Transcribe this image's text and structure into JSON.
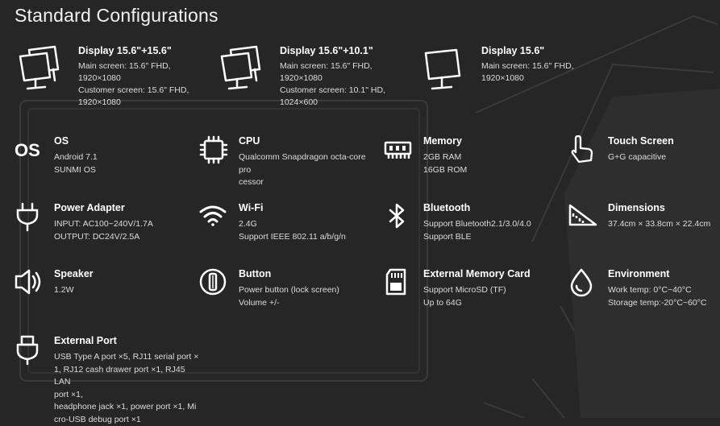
{
  "page": {
    "title": "Standard Configurations"
  },
  "colors": {
    "background": "#262626",
    "text": "#ffffff",
    "subtext": "#dcdcdc",
    "bg_art": "#3a3a3a"
  },
  "displays": [
    {
      "title": "Display 15.6\"+15.6\"",
      "lines": [
        "Main screen: 15.6\" FHD,",
        "1920×1080",
        "Customer screen: 15.6\" FHD,",
        "1920×1080"
      ],
      "icon": "dual-monitor-icon"
    },
    {
      "title": "Display 15.6\"+10.1\"",
      "lines": [
        "Main screen: 15.6\" FHD,",
        "1920×1080",
        "Customer screen: 10.1\" HD,",
        "1024×600"
      ],
      "icon": "dual-monitor-icon"
    },
    {
      "title": "Display 15.6\"",
      "lines": [
        "Main screen: 15.6\" FHD,",
        "1920×1080"
      ],
      "icon": "monitor-icon"
    }
  ],
  "specs": [
    {
      "title": "OS",
      "lines": [
        "Android 7.1",
        "SUNMI OS"
      ],
      "icon": "os-icon",
      "icon_text": "OS"
    },
    {
      "title": "CPU",
      "lines": [
        "Qualcomm Snapdragon octa-core pro",
        "cessor"
      ],
      "icon": "cpu-icon"
    },
    {
      "title": "Memory",
      "lines": [
        "2GB RAM",
        "16GB ROM"
      ],
      "icon": "memory-icon"
    },
    {
      "title": "Touch Screen",
      "lines": [
        "G+G capacitive"
      ],
      "icon": "touch-hand-icon"
    },
    {
      "title": "Power Adapter",
      "lines": [
        "INPUT: AC100~240V/1.7A",
        "OUTPUT: DC24V/2.5A"
      ],
      "icon": "plug-icon"
    },
    {
      "title": "Wi-Fi",
      "lines": [
        "2.4G",
        "Support IEEE 802.11 a/b/g/n"
      ],
      "icon": "wifi-icon"
    },
    {
      "title": "Bluetooth",
      "lines": [
        "Support Bluetooth2.1/3.0/4.0",
        "Support BLE"
      ],
      "icon": "bluetooth-icon"
    },
    {
      "title": "Dimensions",
      "lines": [
        "37.4cm × 33.8cm × 22.4cm"
      ],
      "icon": "dimensions-icon"
    },
    {
      "title": "Speaker",
      "lines": [
        "1.2W"
      ],
      "icon": "speaker-icon"
    },
    {
      "title": "Button",
      "lines": [
        "Power button (lock screen)",
        "Volume +/-"
      ],
      "icon": "button-icon"
    },
    {
      "title": "External Memory Card",
      "lines": [
        "Support MicroSD (TF)",
        "Up to 64G"
      ],
      "icon": "sd-card-icon"
    },
    {
      "title": "Environment",
      "lines": [
        "Work temp: 0°C~40°C",
        "Storage temp:-20°C~60°C"
      ],
      "icon": "droplet-icon"
    },
    {
      "title": "External Port",
      "lines": [
        "USB Type A port ×5, RJ11 serial port ×",
        "1, RJ12 cash drawer port ×1, RJ45 LAN",
        "port ×1,",
        "headphone jack ×1, power port ×1, Mi",
        "cro-USB debug port ×1"
      ],
      "icon": "usb-port-icon"
    }
  ]
}
